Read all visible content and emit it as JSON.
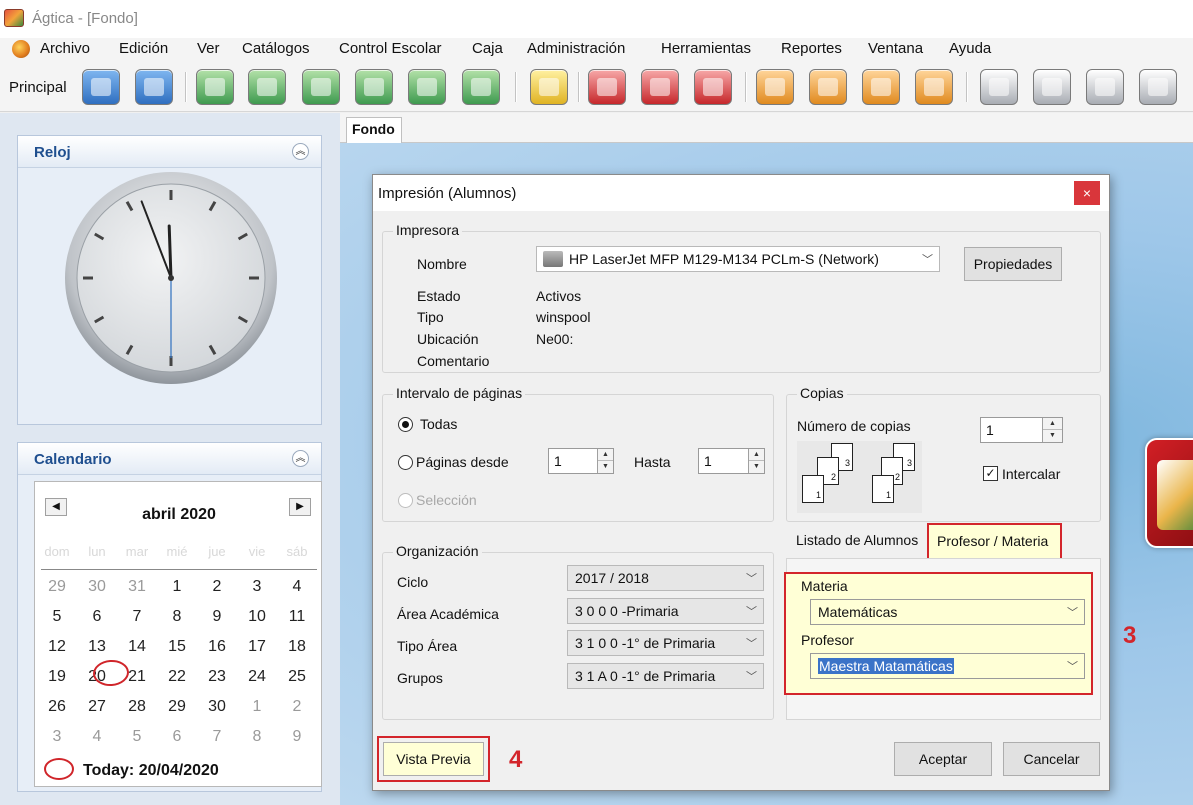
{
  "window": {
    "title": "Ágtica - [Fondo]"
  },
  "menu": {
    "items": [
      {
        "label": "Archivo"
      },
      {
        "label": "Edición"
      },
      {
        "label": "Ver"
      },
      {
        "label": "Catálogos"
      },
      {
        "label": "Control Escolar"
      },
      {
        "label": "Caja"
      },
      {
        "label": "Administración"
      },
      {
        "label": "Herramientas"
      },
      {
        "label": "Reportes"
      },
      {
        "label": "Ventana"
      },
      {
        "label": "Ayuda"
      }
    ]
  },
  "toolbar": {
    "label": "Principal"
  },
  "clock": {
    "title": "Reloj",
    "hour": 11,
    "minute": 56,
    "second": 30
  },
  "calendar": {
    "title": "Calendario",
    "month": "abril 2020",
    "weekdays": [
      "dom",
      "lun",
      "mar",
      "mié",
      "jue",
      "vie",
      "sáb"
    ],
    "weeks": [
      [
        "29",
        "30",
        "31",
        "1",
        "2",
        "3",
        "4"
      ],
      [
        "5",
        "6",
        "7",
        "8",
        "9",
        "10",
        "11"
      ],
      [
        "12",
        "13",
        "14",
        "15",
        "16",
        "17",
        "18"
      ],
      [
        "19",
        "20",
        "21",
        "22",
        "23",
        "24",
        "25"
      ],
      [
        "26",
        "27",
        "28",
        "29",
        "30",
        "1",
        "2"
      ],
      [
        "3",
        "4",
        "5",
        "6",
        "7",
        "8",
        "9"
      ]
    ],
    "today_label": "Today: 20/04/2020"
  },
  "workspace": {
    "tab": "Fondo"
  },
  "dialog": {
    "title": "Impresión (Alumnos)",
    "close": "×",
    "printer": {
      "group": "Impresora",
      "name_label": "Nombre",
      "name_value": "HP LaserJet MFP M129-M134 PCLm-S (Network)",
      "properties_button": "Propiedades",
      "status_label": "Estado",
      "status_value": "Activos",
      "type_label": "Tipo",
      "type_value": "winspool",
      "location_label": "Ubicación",
      "location_value": "Ne00:",
      "comment_label": "Comentario"
    },
    "range": {
      "group": "Intervalo de páginas",
      "all": "Todas",
      "pages_from": "Páginas desde",
      "from_value": "1",
      "to_label": "Hasta",
      "to_value": "1",
      "selection": "Selección"
    },
    "copies": {
      "group": "Copias",
      "count_label": "Número de copias",
      "count_value": "1",
      "collate": "Intercalar"
    },
    "organization": {
      "group": "Organización",
      "ciclo_label": "Ciclo",
      "ciclo_value": "2017 / 2018",
      "area_label": "Área Académica",
      "area_value": "3 0 0 0 -Primaria",
      "tipo_label": "Tipo Área",
      "tipo_value": "3 1 0 0 -1° de Primaria",
      "grupos_label": "Grupos",
      "grupos_value": "3 1 A 0 -1° de Primaria"
    },
    "tabs": {
      "tab1": "Listado de Alumnos",
      "tab2": "Profesor / Materia"
    },
    "teacher": {
      "materia_label": "Materia",
      "materia_value": "Matemáticas",
      "profesor_label": "Profesor",
      "profesor_value": "Maestra Matamáticas"
    },
    "buttons": {
      "preview": "Vista Previa",
      "accept": "Aceptar",
      "cancel": "Cancelar"
    }
  },
  "annotations": {
    "step3": "3",
    "step4": "4"
  }
}
